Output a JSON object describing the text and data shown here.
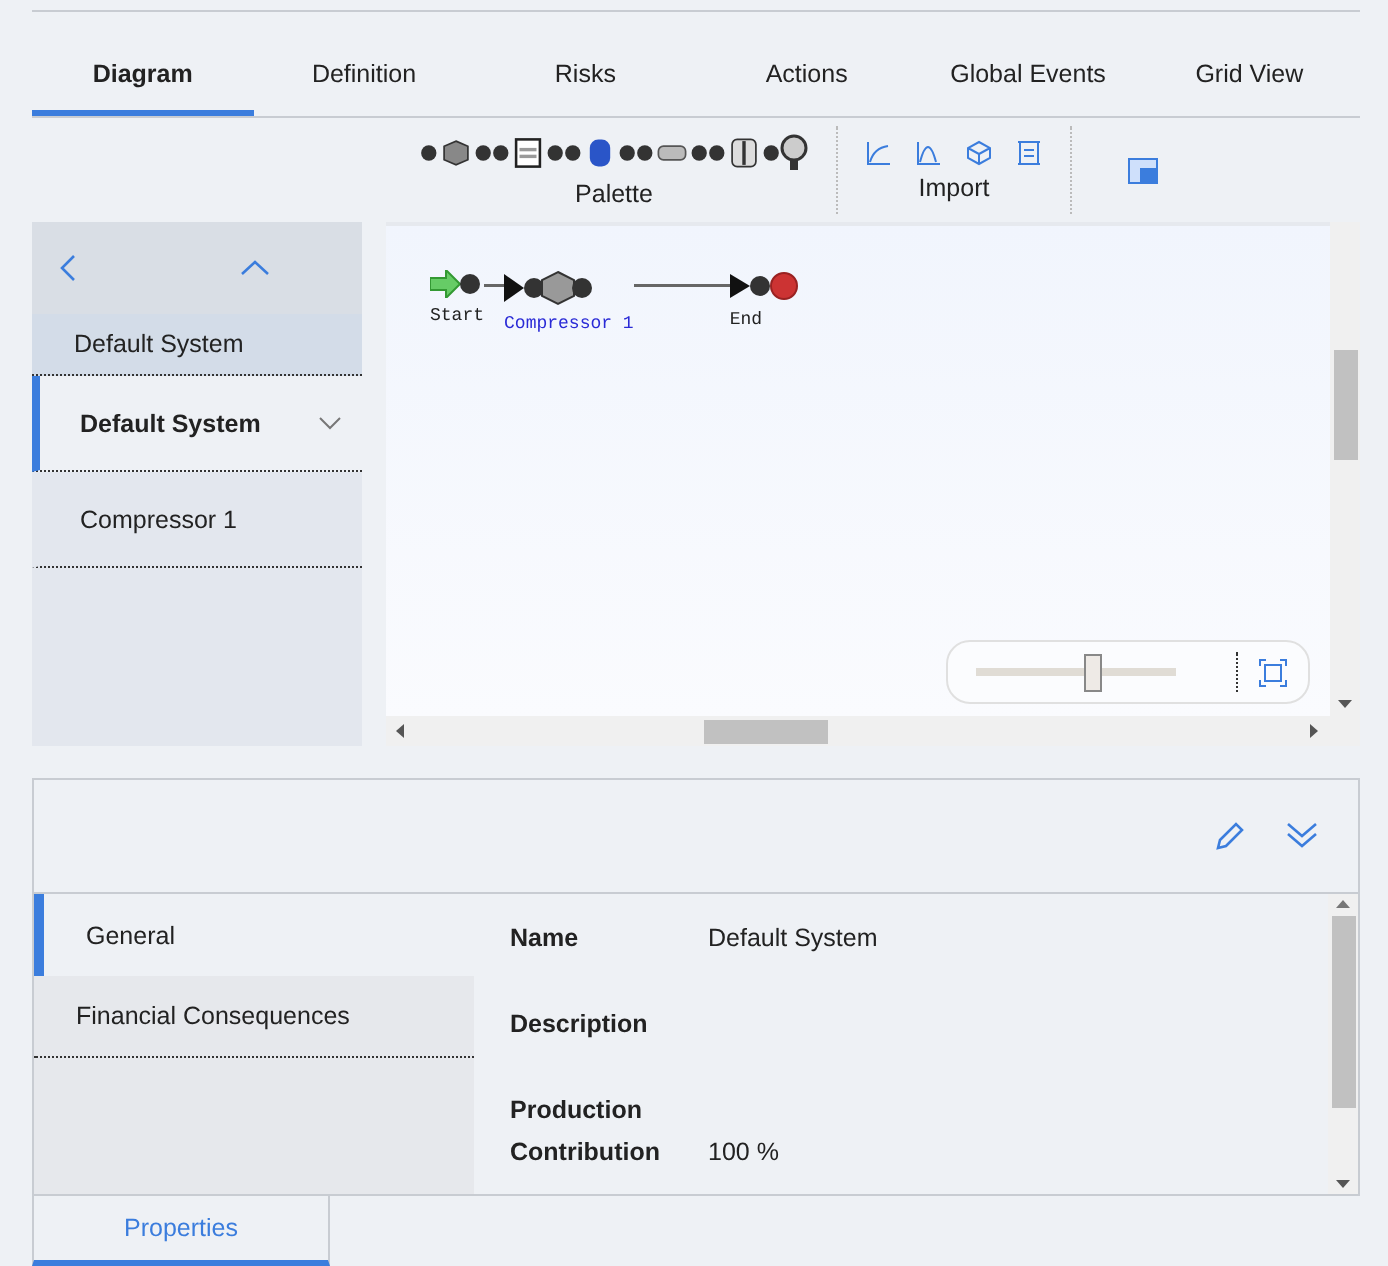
{
  "tabs": [
    {
      "label": "Diagram",
      "selected": true
    },
    {
      "label": "Definition",
      "selected": false
    },
    {
      "label": "Risks",
      "selected": false
    },
    {
      "label": "Actions",
      "selected": false
    },
    {
      "label": "Global Events",
      "selected": false
    },
    {
      "label": "Grid View",
      "selected": false
    }
  ],
  "toolbar": {
    "palette_label": "Palette",
    "import_label": "Import"
  },
  "sidebar": {
    "items": [
      {
        "label": "Default System",
        "kind": "parent",
        "selected": false
      },
      {
        "label": "Default System",
        "kind": "node",
        "selected": true
      },
      {
        "label": "Compressor 1",
        "kind": "node",
        "selected": false
      }
    ]
  },
  "diagram": {
    "nodes": [
      {
        "kind": "start",
        "label": "Start"
      },
      {
        "kind": "asset",
        "label": "Compressor 1"
      },
      {
        "kind": "end",
        "label": "End"
      }
    ],
    "zoom": {
      "level": 0.58
    }
  },
  "details": {
    "nav": [
      {
        "label": "General",
        "selected": true
      },
      {
        "label": "Financial Consequences",
        "selected": false
      }
    ],
    "fields": [
      {
        "label": "Name",
        "value": "Default System"
      },
      {
        "label": "Description"
      },
      {
        "label": "Production Contribution",
        "value": "100 %"
      }
    ]
  },
  "bottom_tabs": [
    {
      "label": "Properties",
      "selected": true
    }
  ]
}
